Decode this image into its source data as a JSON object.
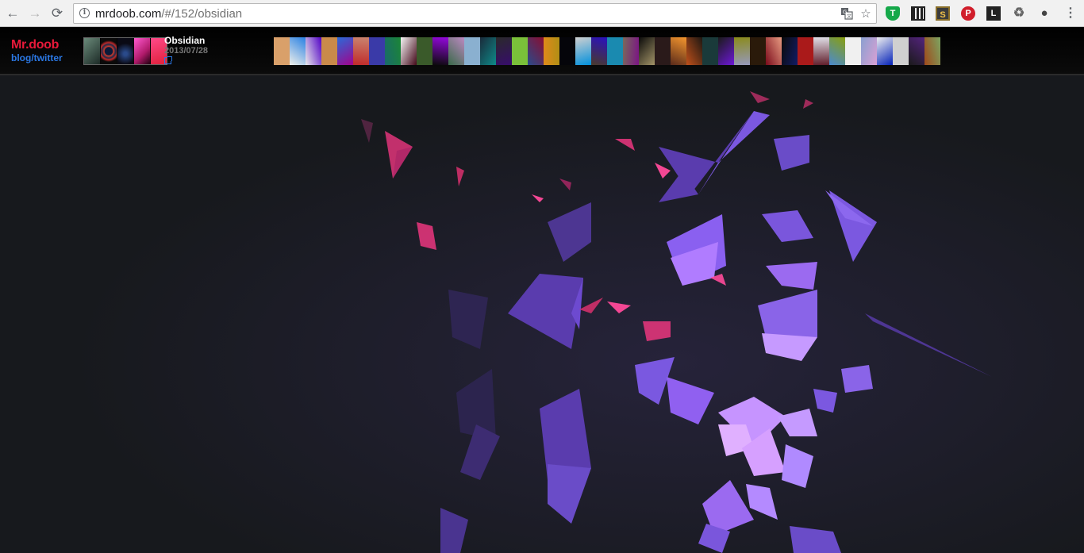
{
  "browser": {
    "url_host": "mrdoob.com",
    "url_path": "/#/152/obsidian",
    "nav": {
      "back": "←",
      "forward": "→",
      "reload": "⟳"
    },
    "omnibox_icons": [
      "translate-icon",
      "star-icon"
    ],
    "extensions": [
      "shield-extension-icon",
      "qr-code-extension-icon",
      "s-extension-icon",
      "pinterest-icon",
      "l-extension-icon",
      "recycle-extension-icon",
      "evernote-icon",
      "menu-icon"
    ]
  },
  "site": {
    "logo": "Mr.doob",
    "blog_link": "blog",
    "separator": "/",
    "twitter_link": "twitter",
    "demo_title": "Obsidian",
    "demo_date": "2013/07/28"
  },
  "colors": {
    "background": "#17191d",
    "header_bg": "#000000",
    "logo_red": "#e8193a",
    "link_blue": "#2b78e4",
    "shard_purple": "#7b4fd6",
    "shard_pink": "#e0357a"
  }
}
